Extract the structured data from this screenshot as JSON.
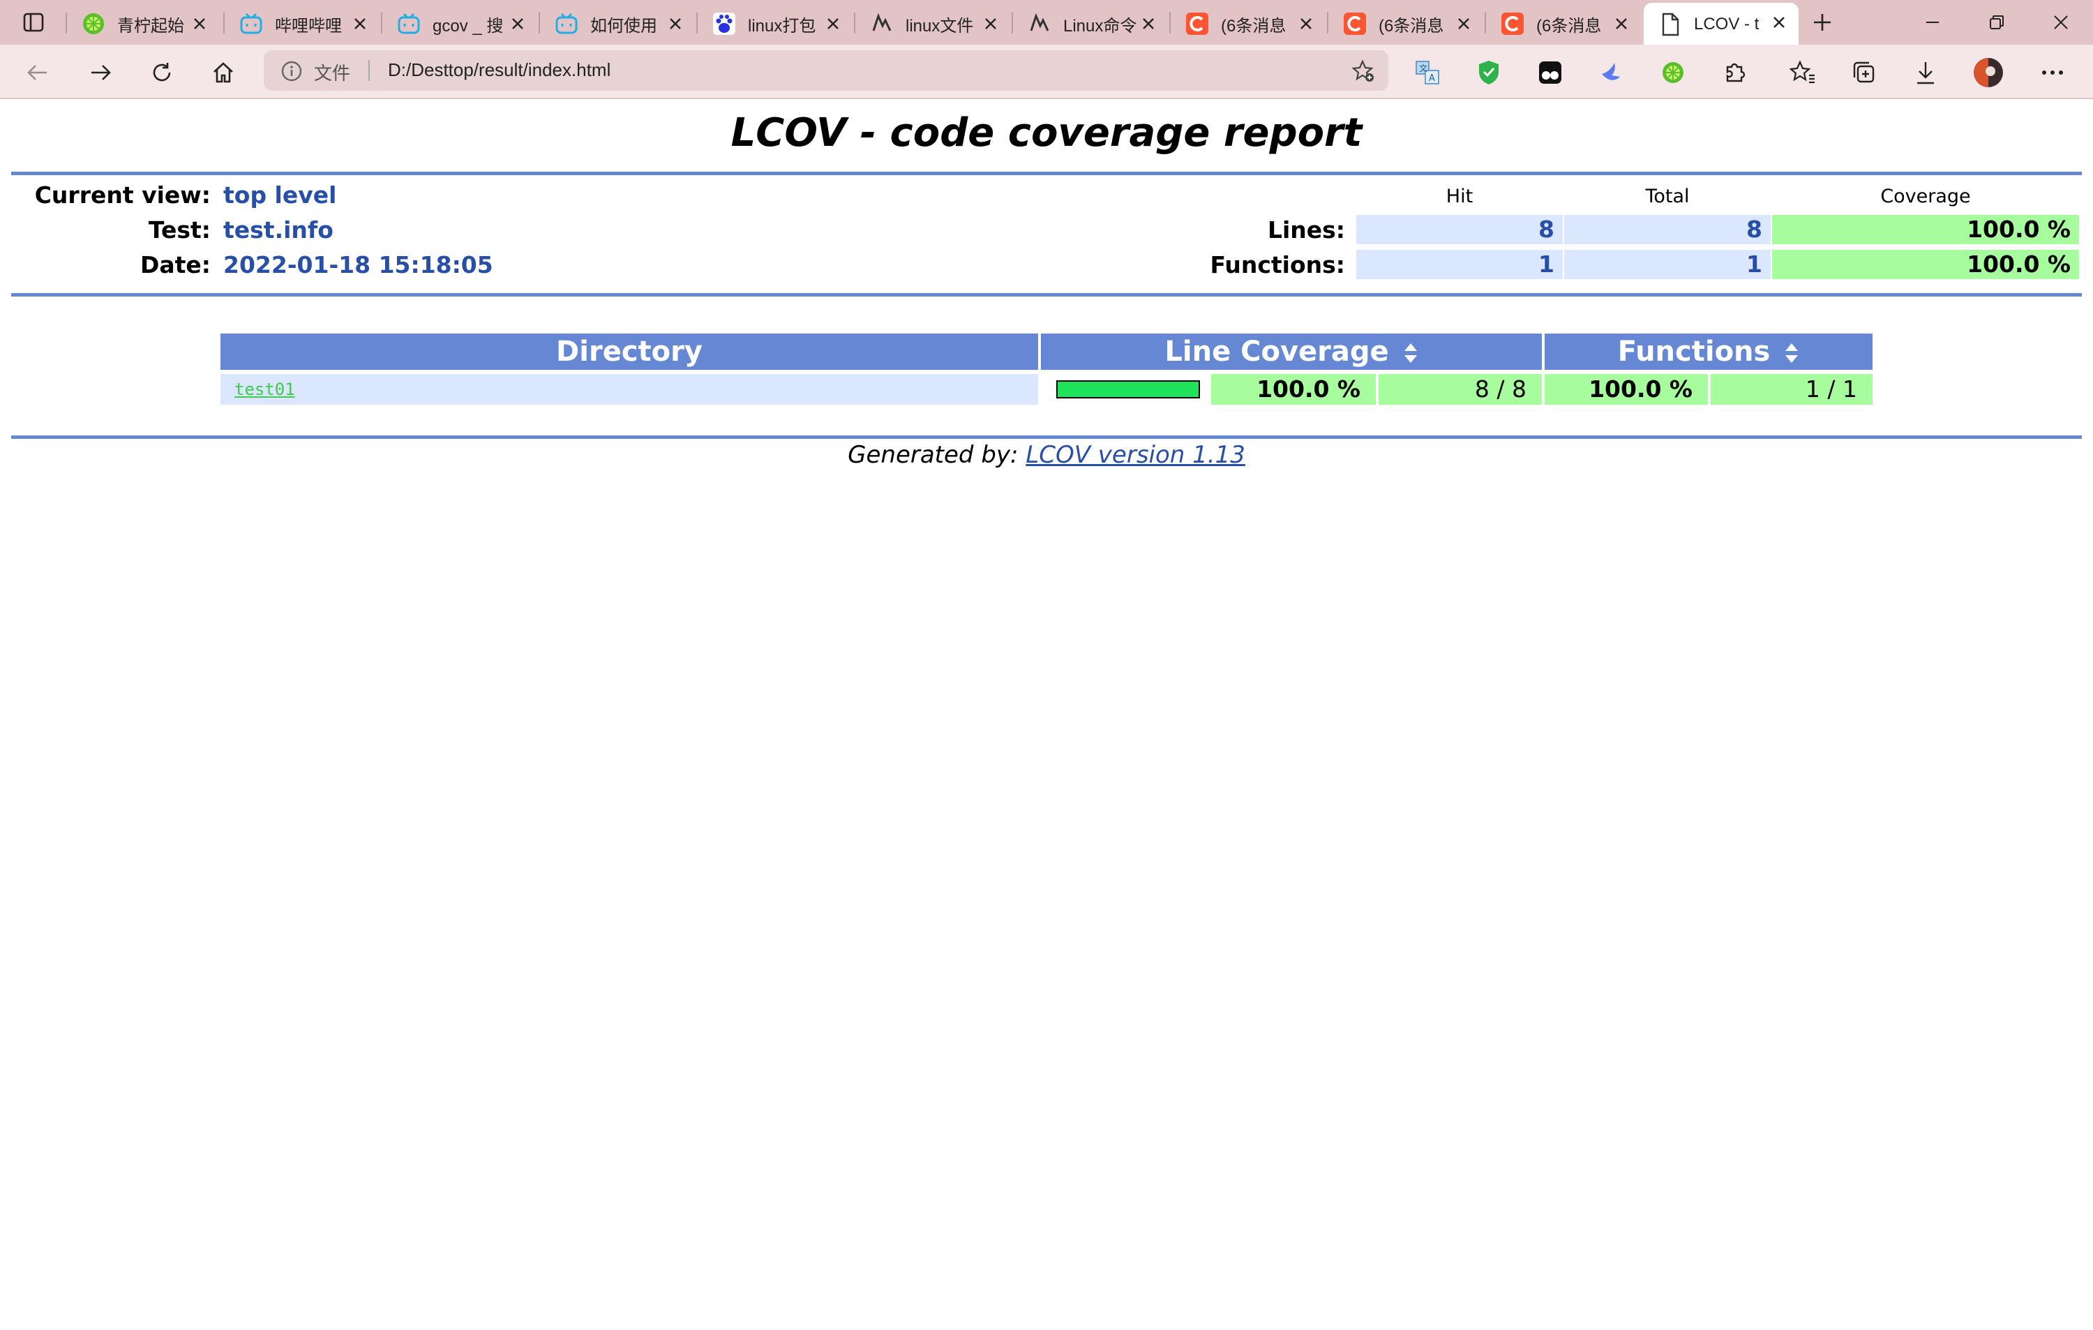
{
  "browser": {
    "tabs": [
      {
        "title": "青柠起始",
        "icon": "lime-icon",
        "color": "#5bbf2a"
      },
      {
        "title": "哔哩哔哩",
        "icon": "bilibili-icon",
        "color": "#23ade5"
      },
      {
        "title": "gcov _ 搜",
        "icon": "bilibili-icon",
        "color": "#23ade5"
      },
      {
        "title": "如何使用",
        "icon": "bilibili-icon",
        "color": "#23ade5"
      },
      {
        "title": "linux打包",
        "icon": "baidu-paw-icon",
        "color": "#2932e1"
      },
      {
        "title": "linux文件",
        "icon": "zhihu-like-icon",
        "color": "#333333"
      },
      {
        "title": "Linux命令",
        "icon": "zhihu-like-icon",
        "color": "#333333"
      },
      {
        "title": "(6条消息",
        "icon": "csdn-icon",
        "color": "#fc5531"
      },
      {
        "title": "(6条消息",
        "icon": "csdn-icon",
        "color": "#fc5531"
      },
      {
        "title": "(6条消息",
        "icon": "csdn-icon",
        "color": "#fc5531"
      },
      {
        "title": "LCOV - t",
        "icon": "page-icon",
        "color": "#333333",
        "active": true
      }
    ],
    "address": {
      "label": "文件",
      "url": "D:/Desttop/result/index.html"
    }
  },
  "report": {
    "title": "LCOV - code coverage report",
    "current_view_label": "Current view:",
    "current_view": "top level",
    "test_label": "Test:",
    "test": "test.info",
    "date_label": "Date:",
    "date": "2022-01-18 15:18:05",
    "summary": {
      "hit_header": "Hit",
      "total_header": "Total",
      "coverage_header": "Coverage",
      "lines_label": "Lines:",
      "lines_hit": "8",
      "lines_total": "8",
      "lines_coverage": "100.0 %",
      "functions_label": "Functions:",
      "functions_hit": "1",
      "functions_total": "1",
      "functions_coverage": "100.0 %"
    },
    "table": {
      "col_directory": "Directory",
      "col_line_coverage": "Line Coverage",
      "col_functions": "Functions",
      "rows": [
        {
          "directory": "test01",
          "line_coverage_fraction": 1.0,
          "line_pct": "100.0 %",
          "line_ratio": "8 / 8",
          "func_pct": "100.0 %",
          "func_ratio": "1 / 1"
        }
      ]
    },
    "footer_prefix": "Generated by:",
    "footer_link": "LCOV version 1.13"
  }
}
